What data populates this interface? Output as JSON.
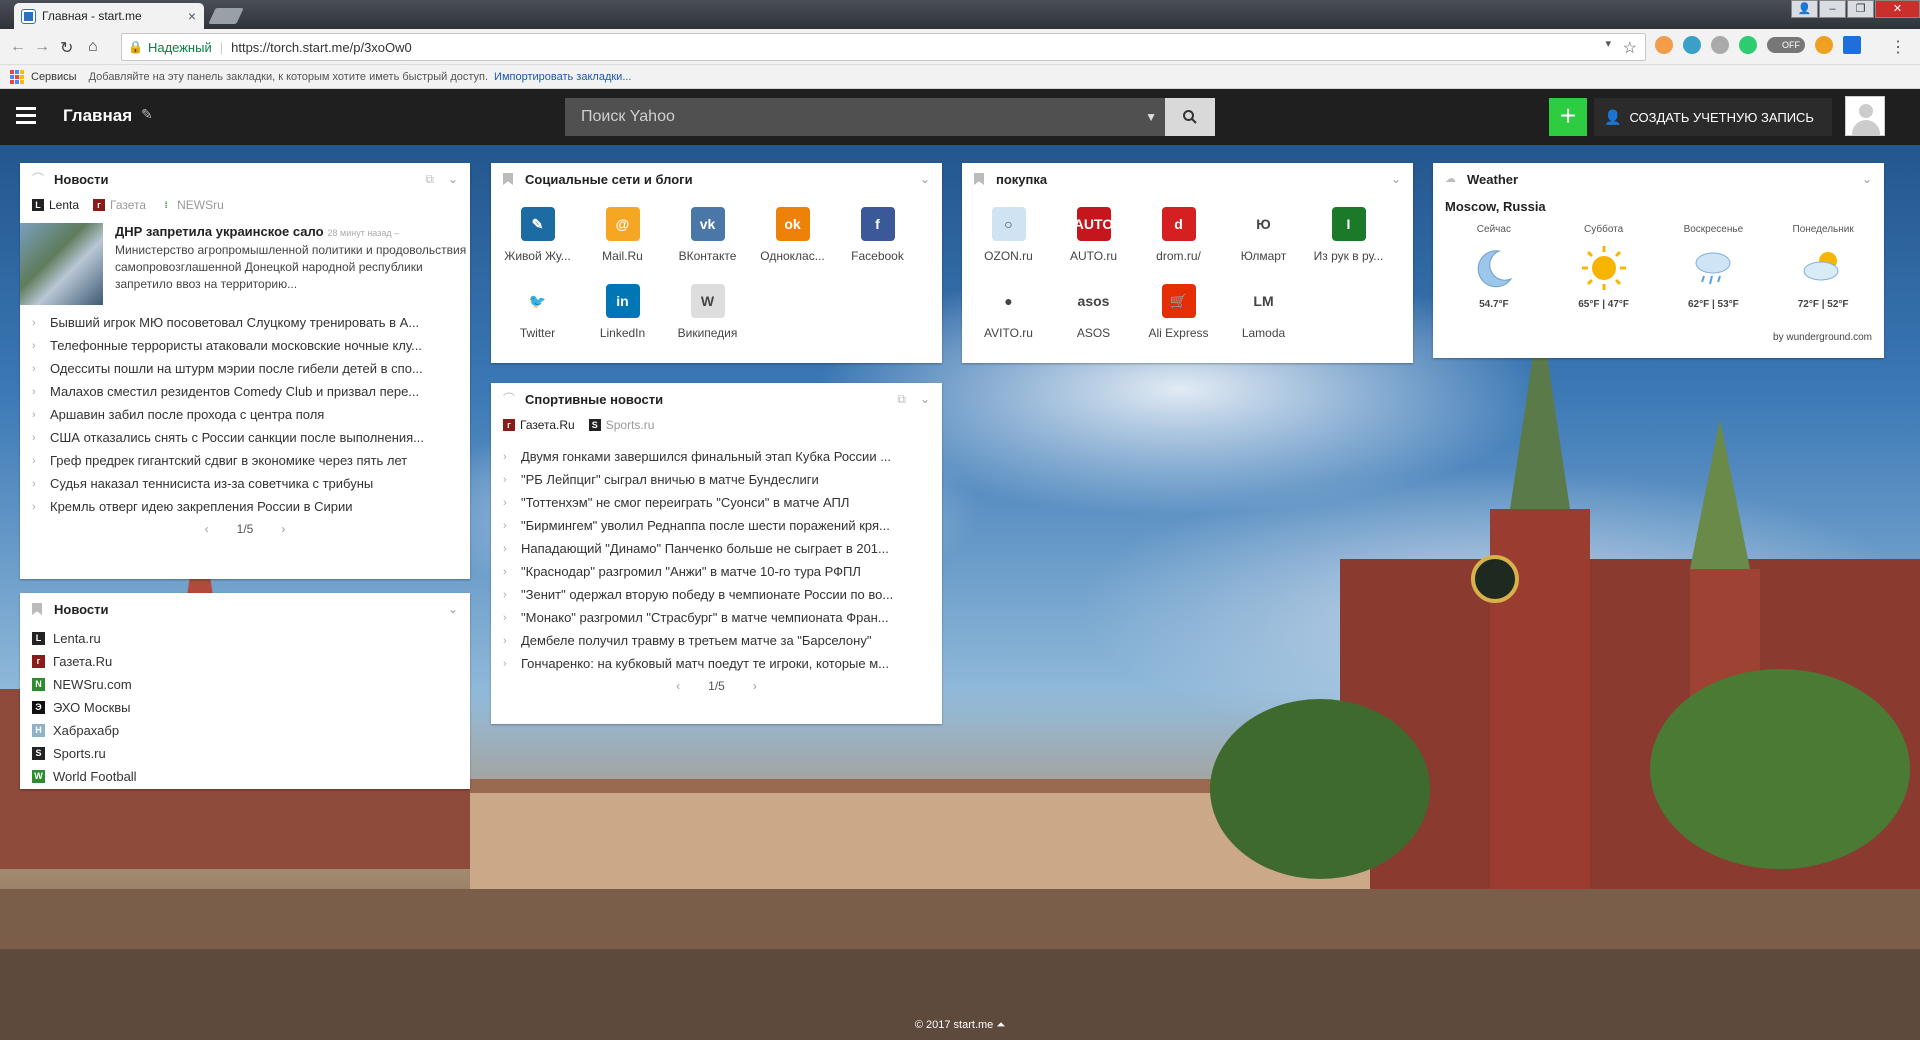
{
  "browser": {
    "tab_title": "Главная - start.me",
    "secure_label": "Надежный",
    "url": "https://torch.start.me/p/3xoOw0",
    "toggle_label": "OFF",
    "bookmarks_apps": "Сервисы",
    "bookmarks_hint": "Добавляйте на эту панель закладки, к которым хотите иметь быстрый доступ.",
    "bookmarks_import": "Импортировать закладки..."
  },
  "topbar": {
    "title": "Главная",
    "search_placeholder": "Поиск Yahoo",
    "plus_label": "+",
    "create_account": "СОЗДАТЬ УЧЕТНУЮ ЗАПИСЬ"
  },
  "news_widget": {
    "title": "Новости",
    "sources": [
      "Lenta",
      "Газета",
      "NEWSru"
    ],
    "featured": {
      "headline": "ДНР запретила украинское сало",
      "ago": "28 минут назад –",
      "summary": "Министерство агропромышленной политики и продовольствия самопровозглашенной Донецкой народной республики запретило ввоз на территорию..."
    },
    "items": [
      "Бывший игрок МЮ посоветовал Слуцкому тренировать в А...",
      "Телефонные террористы атаковали московские ночные клу...",
      "Одесситы пошли на штурм мэрии после гибели детей в спо...",
      "Малахов сместил резидентов Comedy Club и призвал пере...",
      "Аршавин забил после прохода с центра поля",
      "США отказались снять с России санкции после выполнения...",
      "Греф предрек гигантский сдвиг в экономике через пять лет",
      "Судья наказал теннисиста из-за советчика с трибуны",
      "Кремль отверг идею закрепления России в Сирии"
    ],
    "page": "1/5"
  },
  "news_links": {
    "title": "Новости",
    "links": [
      {
        "label": "Lenta.ru",
        "color": "#222222",
        "glyph": "L"
      },
      {
        "label": "Газета.Ru",
        "color": "#8b1a1a",
        "glyph": "г"
      },
      {
        "label": "NEWSru.com",
        "color": "#2e8b2e",
        "glyph": "N"
      },
      {
        "label": "ЭХО Москвы",
        "color": "#111111",
        "glyph": "Э"
      },
      {
        "label": "Хабрахабр",
        "color": "#8fb2c9",
        "glyph": "H"
      },
      {
        "label": "Sports.ru",
        "color": "#222222",
        "glyph": "S"
      },
      {
        "label": "World Football",
        "color": "#2e8b2e",
        "glyph": "W"
      }
    ]
  },
  "social": {
    "title": "Социальные сети и блоги",
    "tiles": [
      {
        "label": "Живой Жу...",
        "color": "#1c6ca3",
        "glyph": "✎"
      },
      {
        "label": "Mail.Ru",
        "color": "#f5a623",
        "glyph": "@"
      },
      {
        "label": "ВКонтакте",
        "color": "#4a76a8",
        "glyph": "vk"
      },
      {
        "label": "Одноклас...",
        "color": "#ee8208",
        "glyph": "ok"
      },
      {
        "label": "Facebook",
        "color": "#3b5998",
        "glyph": "f"
      },
      {
        "label": "Twitter",
        "color": "#ffffff",
        "glyph": "🐦"
      },
      {
        "label": "LinkedIn",
        "color": "#0077b5",
        "glyph": "in"
      },
      {
        "label": "Википедия",
        "color": "#dddddd",
        "glyph": "W"
      }
    ]
  },
  "shopping": {
    "title": "покупка",
    "tiles": [
      {
        "label": "OZON.ru",
        "color": "#cfe3f2",
        "glyph": "○"
      },
      {
        "label": "AUTO.ru",
        "color": "#c4161c",
        "glyph": "AUTO"
      },
      {
        "label": "drom.ru/",
        "color": "#d42020",
        "glyph": "d"
      },
      {
        "label": "Юлмарт",
        "color": "#ffffff",
        "glyph": "Ю"
      },
      {
        "label": "Из рук в ру...",
        "color": "#1a7a2a",
        "glyph": "I"
      },
      {
        "label": "AVITO.ru",
        "color": "#ffffff",
        "glyph": "●"
      },
      {
        "label": "ASOS",
        "color": "#ffffff",
        "glyph": "asos"
      },
      {
        "label": "Ali Express",
        "color": "#e62e04",
        "glyph": "🛒"
      },
      {
        "label": "Lamoda",
        "color": "#ffffff",
        "glyph": "LM"
      }
    ]
  },
  "weather": {
    "title": "Weather",
    "city": "Moscow, Russia",
    "days": [
      {
        "name": "Сейчас",
        "temp": "54.7°F",
        "icon": "moon-icon"
      },
      {
        "name": "Суббота",
        "temp": "65°F | 47°F",
        "icon": "sun-icon"
      },
      {
        "name": "Воскресенье",
        "temp": "62°F | 53°F",
        "icon": "rain-icon"
      },
      {
        "name": "Понедельник",
        "temp": "72°F | 52°F",
        "icon": "partly-cloudy-icon"
      }
    ],
    "credit": "by wunderground.com"
  },
  "sports": {
    "title": "Спортивные новости",
    "sources": [
      "Газета.Ru",
      "Sports.ru"
    ],
    "items": [
      "Двумя гонками завершился финальный этап Кубка России ...",
      "\"РБ Лейпциг\" сыграл вничью в матче Бундеслиги",
      "\"Тоттенхэм\" не смог переиграть \"Суонси\" в матче АПЛ",
      "\"Бирмингем\" уволил Реднаппа после шести поражений кря...",
      "Нападающий \"Динамо\" Панченко больше не сыграет в 201...",
      "\"Краснодар\" разгромил \"Анжи\" в матче 10-го тура РФПЛ",
      "\"Зенит\" одержал вторую победу в чемпионате России по во...",
      "\"Монако\" разгромил \"Страсбург\" в матче чемпионата Фран...",
      "Дембеле получил травму в третьем матче за \"Барселону\"",
      "Гончаренко: на кубковый матч поедут те игроки, которые м..."
    ],
    "page": "1/5"
  },
  "footer": "© 2017 start.me ⏶"
}
